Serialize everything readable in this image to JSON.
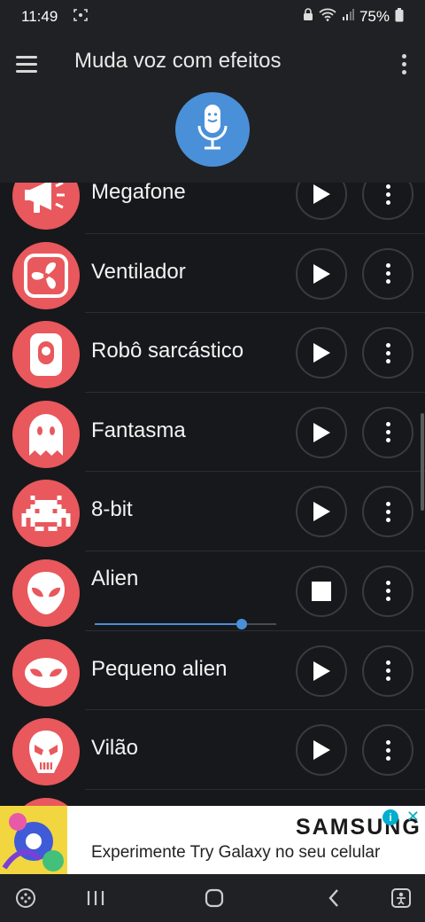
{
  "status_bar": {
    "time": "11:49",
    "battery": "75%"
  },
  "app_bar": {
    "title": "Muda voz com efeitos",
    "menu_icon": "hamburger-menu-icon",
    "overflow_icon": "more-vert-icon",
    "record_icon": "microphone-icon"
  },
  "effects": [
    {
      "label": "Megafone",
      "icon": "megaphone-icon"
    },
    {
      "label": "Ventilador",
      "icon": "fan-icon"
    },
    {
      "label": "Robô sarcástico",
      "icon": "robot-icon"
    },
    {
      "label": "Fantasma",
      "icon": "ghost-icon"
    },
    {
      "label": "8-bit",
      "icon": "space-invader-icon"
    },
    {
      "label": "Alien",
      "icon": "alien-icon",
      "playing": true,
      "progress": 0.81
    },
    {
      "label": "Pequeno alien",
      "icon": "small-alien-icon"
    },
    {
      "label": "Vilão",
      "icon": "villain-mask-icon"
    }
  ],
  "ad": {
    "brand": "SAMSUNG",
    "tagline": "Experimente Try Galaxy no seu celular",
    "info_label": "i",
    "close_label": "✕"
  },
  "colors": {
    "accent": "#4a90d9",
    "avatar": "#e8585c",
    "background": "#17181b",
    "appbar": "#202124"
  }
}
